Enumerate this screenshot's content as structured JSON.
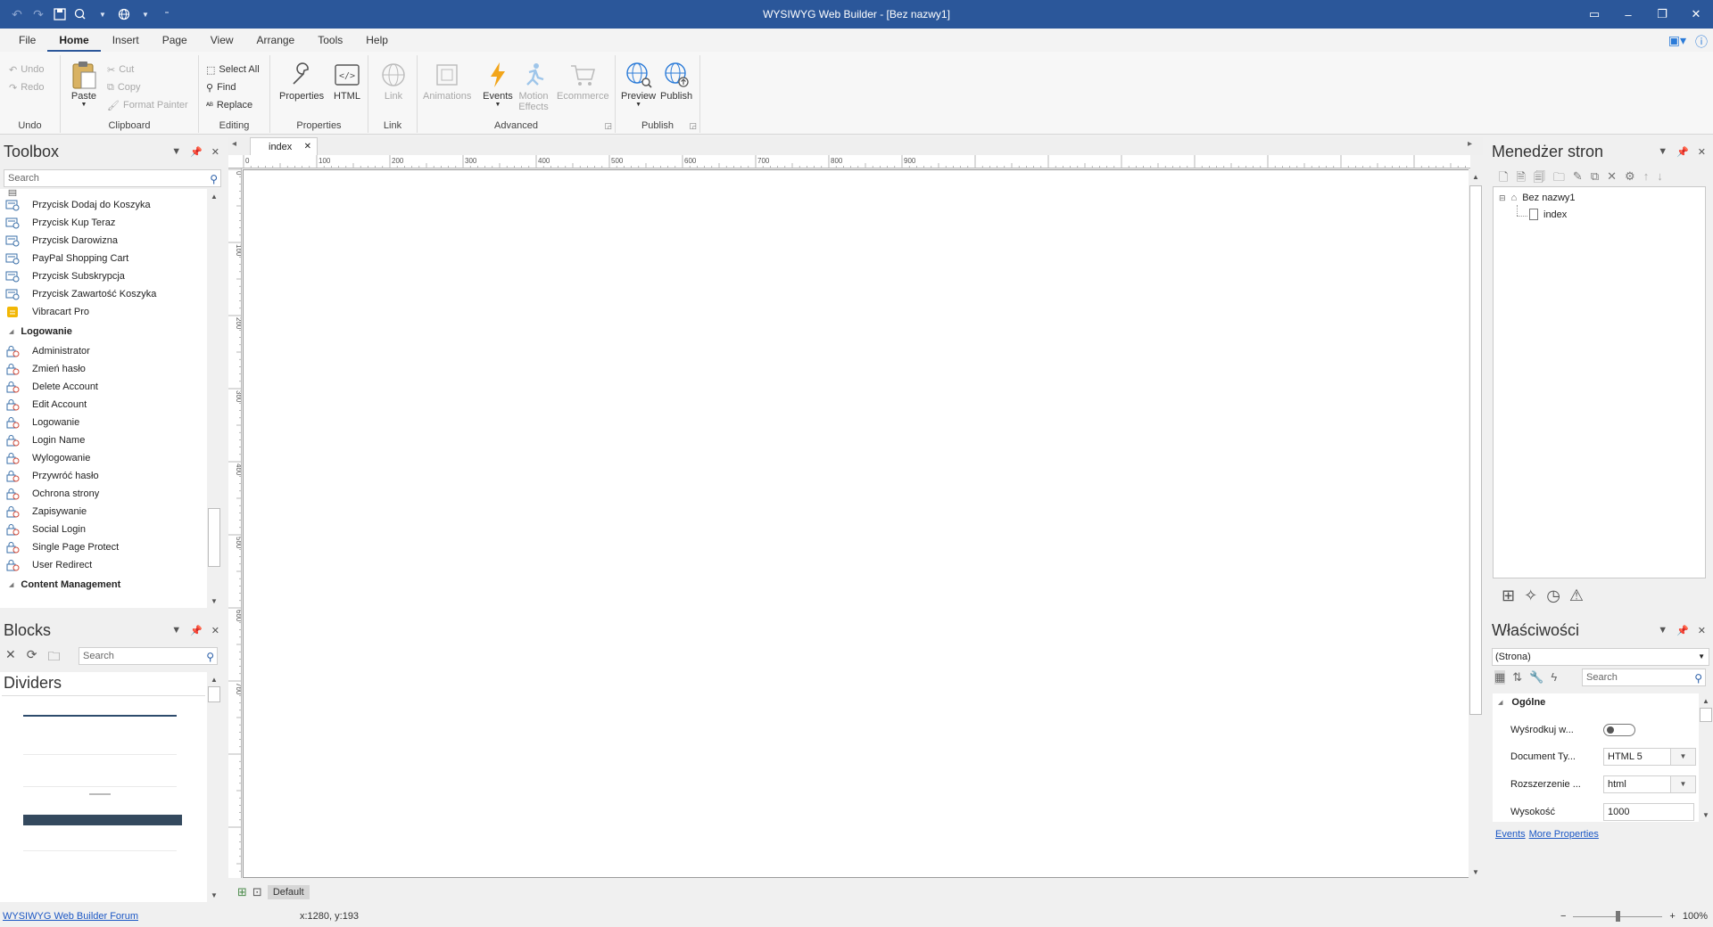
{
  "window": {
    "title": "WYSIWYG Web Builder - [Bez nazwy1]"
  },
  "menu": {
    "tabs": [
      "File",
      "Home",
      "Insert",
      "Page",
      "View",
      "Arrange",
      "Tools",
      "Help"
    ],
    "active": "Home"
  },
  "ribbon": {
    "undo": {
      "undo": "Undo",
      "redo": "Redo",
      "group": "Undo"
    },
    "clipboard": {
      "paste": "Paste",
      "cut": "Cut",
      "copy": "Copy",
      "format_painter": "Format Painter",
      "group": "Clipboard"
    },
    "editing": {
      "select_all": "Select All",
      "find": "Find",
      "replace": "Replace",
      "group": "Editing"
    },
    "properties": {
      "properties": "Properties",
      "html": "HTML",
      "group": "Properties"
    },
    "link": {
      "link": "Link",
      "group": "Link"
    },
    "advanced": {
      "animations": "Animations",
      "events": "Events",
      "motion_effects_1": "Motion",
      "motion_effects_2": "Effects",
      "ecommerce": "Ecommerce",
      "group": "Advanced"
    },
    "publish": {
      "preview": "Preview",
      "publish": "Publish",
      "group": "Publish"
    }
  },
  "toolbox": {
    "title": "Toolbox",
    "search_placeholder": "Search",
    "items": [
      {
        "label": "Przycisk Dodaj do Koszyka",
        "icon": "cart-button-icon"
      },
      {
        "label": "Przycisk Kup Teraz",
        "icon": "cart-button-icon"
      },
      {
        "label": "Przycisk Darowizna",
        "icon": "cart-button-icon"
      },
      {
        "label": "PayPal Shopping Cart",
        "icon": "cart-button-icon"
      },
      {
        "label": "Przycisk Subskrypcja",
        "icon": "cart-button-icon"
      },
      {
        "label": "Przycisk Zawartość Koszyka",
        "icon": "cart-button-icon"
      },
      {
        "label": "Vibracart Pro",
        "icon": "vibracart-icon"
      }
    ],
    "category_login": "Logowanie",
    "login_items": [
      {
        "label": "Administrator"
      },
      {
        "label": "Zmień hasło"
      },
      {
        "label": "Delete Account"
      },
      {
        "label": "Edit Account"
      },
      {
        "label": "Logowanie"
      },
      {
        "label": "Login Name"
      },
      {
        "label": "Wylogowanie"
      },
      {
        "label": "Przywróć hasło"
      },
      {
        "label": "Ochrona strony"
      },
      {
        "label": "Zapisywanie"
      },
      {
        "label": "Social Login"
      },
      {
        "label": "Single Page Protect"
      },
      {
        "label": "User Redirect"
      }
    ],
    "category_content": "Content Management"
  },
  "blocks": {
    "title": "Blocks",
    "search_placeholder": "Search",
    "section": "Dividers"
  },
  "document": {
    "tab": "index",
    "ruler_h": [
      "0",
      "100",
      "200",
      "300",
      "400",
      "500",
      "600",
      "700",
      "800",
      "900"
    ],
    "ruler_v": [
      "0",
      "100",
      "200",
      "300",
      "400",
      "500",
      "600",
      "700"
    ],
    "layout_label": "Default"
  },
  "page_manager": {
    "title": "Menedżer stron",
    "root": "Bez nazwy1",
    "page": "index"
  },
  "properties": {
    "title": "Właściwości",
    "selector": "(Strona)",
    "search_placeholder": "Search",
    "section": "Ogólne",
    "rows": [
      {
        "key": "Wyśrodkuj w...",
        "value": ""
      },
      {
        "key": "Document Ty...",
        "value": "HTML 5"
      },
      {
        "key": "Rozszerzenie ...",
        "value": "html"
      },
      {
        "key": "Wysokość",
        "value": "1000"
      }
    ],
    "link_events": "Events",
    "link_more": "More Properties"
  },
  "status": {
    "forum_link": "WYSIWYG Web Builder Forum",
    "coords": "x:1280, y:193",
    "zoom": "100%"
  },
  "colors": {
    "titlebar": "#2b579a",
    "accent": "#2b7bd8",
    "link": "#1a56c4"
  }
}
